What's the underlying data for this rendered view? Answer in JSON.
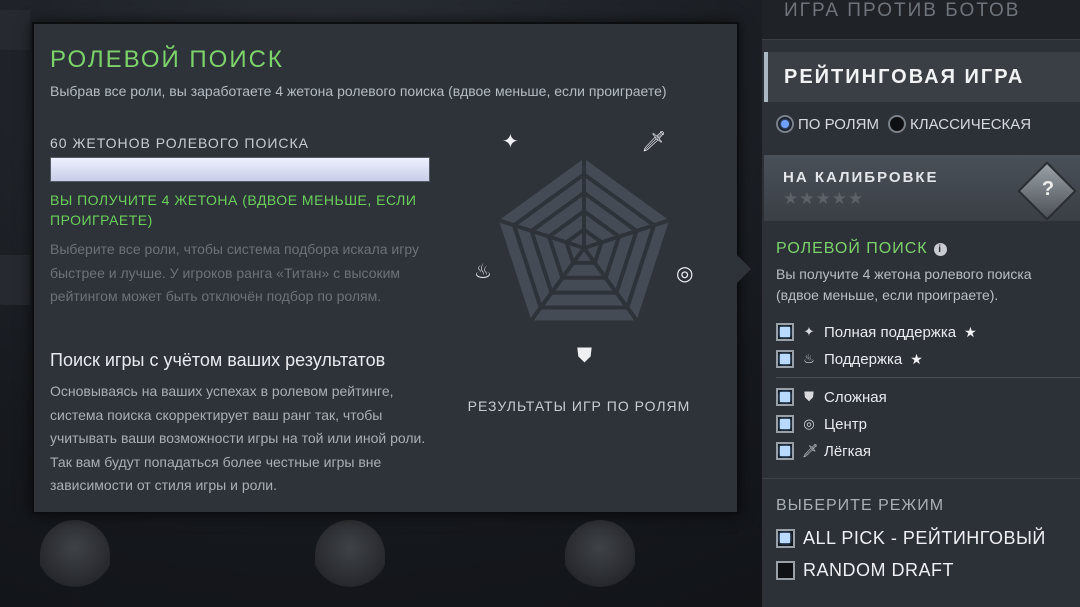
{
  "tooltip": {
    "title": "РОЛЕВОЙ ПОИСК",
    "subtitle": "Выбрав все роли, вы заработаете 4 жетона ролевого поиска (вдвое меньше, если проиграете)",
    "token_label": "60 ЖЕТОНОВ РОЛЕВОГО ПОИСКА",
    "token_progress": 1.0,
    "reward_text": "ВЫ ПОЛУЧИТЕ 4 ЖЕТОНА (ВДВОЕ МЕНЬШЕ, ЕСЛИ ПРОИГРАЕТЕ)",
    "hint_text": "Выберите все роли, чтобы система подбора искала игру быстрее и лучше. У игроков ранга «Титан» с высоким рейтингом может быть отключён подбор по ролям.",
    "section_title": "Поиск игры с учётом ваших результатов",
    "section_body": "Основываясь на ваших успехах в ролевом рейтинге, система поиска скорректирует ваш ранг так, чтобы учитывать ваши возможности игры на той или иной роли. Так вам будут попадаться более честные игры вне зависимости от стиля игры и роли.",
    "radar_caption": "РЕЗУЛЬТАТЫ ИГР ПО РОЛЯМ",
    "radar_roles": [
      {
        "name": "full-support",
        "glyph": "✦"
      },
      {
        "name": "carry",
        "glyph": "🗡"
      },
      {
        "name": "mid",
        "glyph": "◎"
      },
      {
        "name": "offlane",
        "glyph": "⛊"
      },
      {
        "name": "support",
        "glyph": "♨"
      }
    ]
  },
  "right_panel": {
    "bots_label": "ИГРА ПРОТИВ БОТОВ",
    "ranked_label": "РЕЙТИНГОВАЯ ИГРА",
    "radio_roles": "ПО РОЛЯМ",
    "radio_classic": "КЛАССИЧЕСКАЯ",
    "calibration_label": "НА КАЛИБРОВКЕ",
    "calibration_stars": "★★★★★",
    "badge_glyph": "?",
    "role_search_title": "РОЛЕВОЙ ПОИСК",
    "info_glyph": "i",
    "role_search_desc": "Вы получите 4 жетона ролевого поиска (вдвое меньше, если проиграете).",
    "roles": [
      {
        "label": "Полная поддержка",
        "glyph": "✦",
        "star": "★"
      },
      {
        "label": "Поддержка",
        "glyph": "♨",
        "star": "★"
      },
      {
        "label": "Сложная",
        "glyph": "⛊",
        "star": ""
      },
      {
        "label": "Центр",
        "glyph": "◎",
        "star": ""
      },
      {
        "label": "Лёгкая",
        "glyph": "🗡",
        "star": ""
      }
    ],
    "mode_title": "ВЫБЕРИТЕ РЕЖИМ",
    "modes": [
      {
        "label": "ALL PICK - РЕЙТИНГОВЫЙ",
        "checked": true
      },
      {
        "label": "RANDOM DRAFT",
        "checked": false
      }
    ]
  }
}
